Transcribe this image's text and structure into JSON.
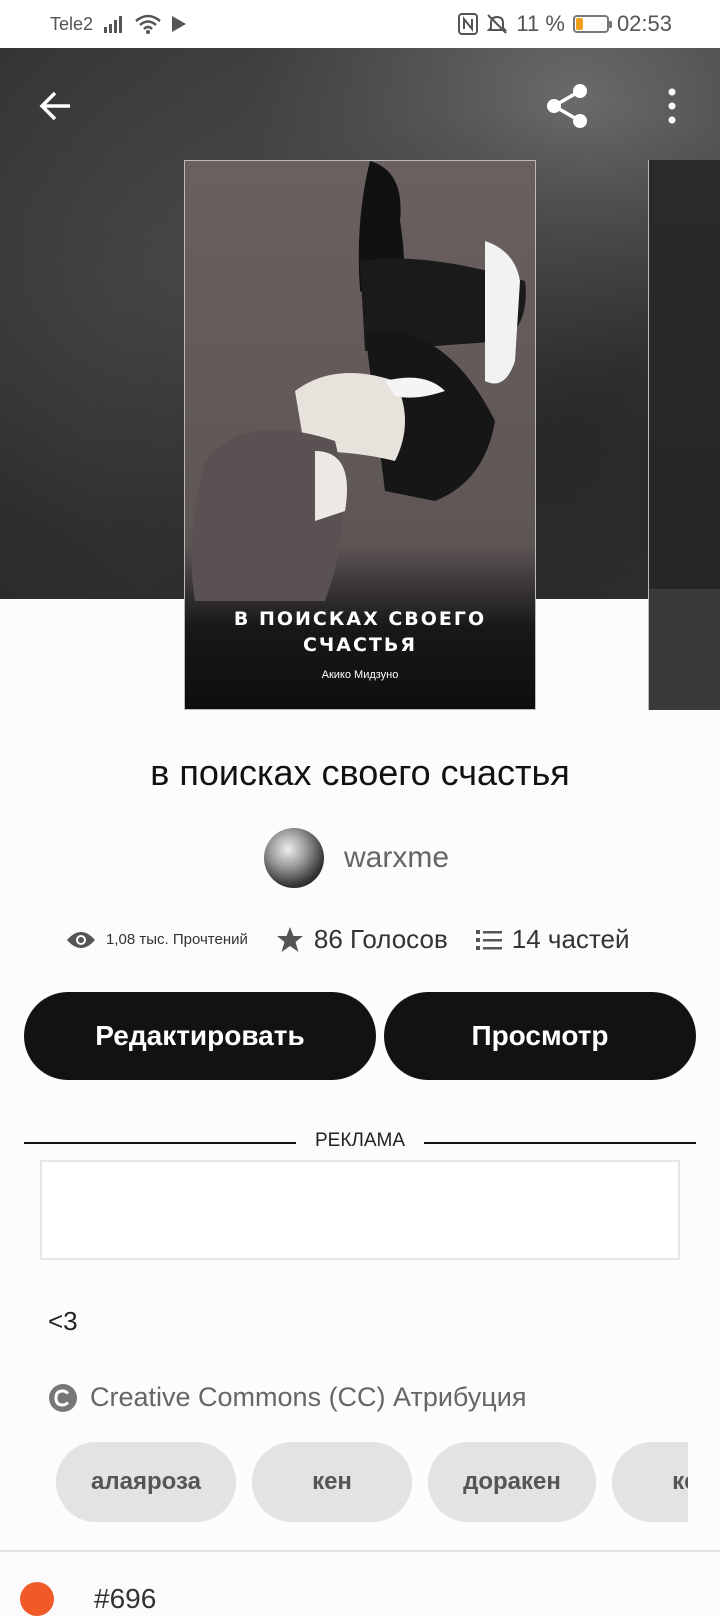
{
  "status_bar": {
    "carrier": "Tele2",
    "battery_percent": "11 %",
    "battery_level": 0.11,
    "time": "02:53",
    "icons": [
      "signal-icon",
      "wifi-icon",
      "play-icon",
      "nfc-icon",
      "mute-icon",
      "battery-icon"
    ]
  },
  "toolbar": {
    "back_icon": "arrow-back-icon",
    "share_icon": "share-icon",
    "more_icon": "more-vert-icon"
  },
  "cover": {
    "title_line1": "В ПОИСКАХ СВОЕГО",
    "title_line2": "СЧАСТЬЯ",
    "author": "Акико Мидзуно"
  },
  "story": {
    "title": "в поисках своего счастья",
    "author": "warxme"
  },
  "stats": {
    "reads": "1,08 тыс. Прочтений",
    "votes": "86 Голосов",
    "parts": "14 частей"
  },
  "buttons": {
    "edit": "Редактировать",
    "view": "Просмотр"
  },
  "ad": {
    "label": "РЕКЛАМА"
  },
  "description": "<3",
  "license": {
    "icon": "creative-commons-icon",
    "text": "Creative Commons (CC) Атрибуция"
  },
  "tags": [
    "алаяроза",
    "кен",
    "доракен",
    "кен"
  ],
  "bottom_peek": {
    "text": "#696"
  },
  "colors": {
    "primary_button": "#121212",
    "tag_bg": "#e4e2e5",
    "accent": "#f05a28"
  }
}
